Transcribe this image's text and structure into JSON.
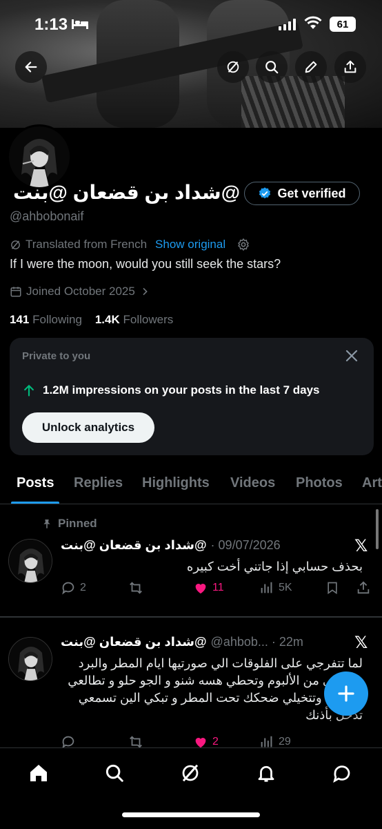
{
  "status_bar": {
    "time": "1:13",
    "battery": "61"
  },
  "profile": {
    "display_name": "@شداد بن قضعان @بنت",
    "verify_label": "Get verified",
    "handle": "@ahbobonaif",
    "translated_label": "Translated from French",
    "show_original_label": "Show original",
    "bio": "If I were the moon, would you still seek the stars?",
    "joined": "Joined October 2025",
    "following_count": "141",
    "following_label": "Following",
    "followers_count": "1.4K",
    "followers_label": "Followers"
  },
  "private_card": {
    "label": "Private to you",
    "impressions": "1.2M impressions on your posts in the last 7 days",
    "unlock_label": "Unlock analytics"
  },
  "tabs": [
    {
      "label": "Posts",
      "active": true
    },
    {
      "label": "Replies"
    },
    {
      "label": "Highlights"
    },
    {
      "label": "Videos"
    },
    {
      "label": "Photos"
    },
    {
      "label": "Art"
    }
  ],
  "posts": [
    {
      "pinned_label": "Pinned",
      "author": "@شداد بن قضعان @بنت",
      "meta": "· 09/07/2026",
      "text": "بحذف حسابي إذا جاتني أخت كبيره",
      "replies": "2",
      "likes": "11",
      "views": "5K"
    },
    {
      "author": "@شداد بن قضعان @بنت",
      "meta": "@ahbob... · 22m",
      "text": "لما تتفرجي على الفلوقات الي صورتيها ايام المطر والبرد وتطلعي من الألبوم وتحطي هسه شنو و الجو حلو و تطالعي السقف وتتخيلي ضحكك تحت المطر و تبكي الين تسمعي تدخل بأذنك",
      "likes": "2",
      "views": "29"
    }
  ],
  "colors": {
    "accent": "#1d9bf0",
    "like": "#f91880",
    "card_bg": "#16181c"
  },
  "icons": [
    "back-arrow-icon",
    "grok-icon",
    "search-icon",
    "edit-icon",
    "share-icon",
    "settings-icon",
    "calendar-icon",
    "close-icon",
    "pin-icon",
    "x-logo-icon",
    "plus-icon",
    "home-icon",
    "bell-icon",
    "messages-icon"
  ]
}
